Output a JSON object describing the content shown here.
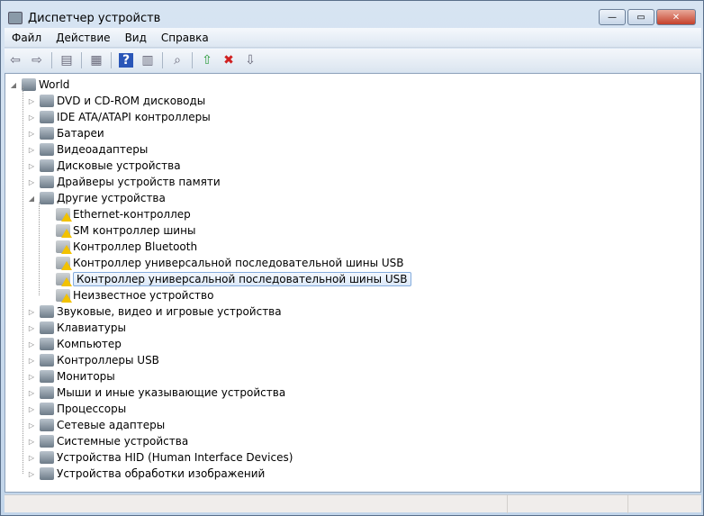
{
  "window": {
    "title": "Диспетчер устройств",
    "minimize": "—",
    "maximize": "▭",
    "close": "✕"
  },
  "menu": [
    "Файл",
    "Действие",
    "Вид",
    "Справка"
  ],
  "toolbar": [
    {
      "icon": "back-icon",
      "g": "⇦"
    },
    {
      "icon": "forward-icon",
      "g": "⇨"
    },
    {
      "sep": true
    },
    {
      "icon": "show-hide-console-tree-icon",
      "g": "▤"
    },
    {
      "sep": true
    },
    {
      "icon": "properties-icon",
      "g": "▦"
    },
    {
      "sep": true
    },
    {
      "icon": "help-icon",
      "g": "?"
    },
    {
      "icon": "show-action-pane-icon",
      "g": "▥"
    },
    {
      "sep": true
    },
    {
      "icon": "scan-hardware-icon",
      "g": "⌕"
    },
    {
      "sep": true
    },
    {
      "icon": "update-driver-icon",
      "g": "⇧"
    },
    {
      "icon": "uninstall-icon",
      "g": "✖"
    },
    {
      "icon": "disable-icon",
      "g": "⇩"
    }
  ],
  "tree": {
    "root": "World",
    "items": [
      {
        "label": "DVD и CD-ROM дисководы"
      },
      {
        "label": "IDE ATA/ATAPI контроллеры"
      },
      {
        "label": "Батареи"
      },
      {
        "label": "Видеоадаптеры"
      },
      {
        "label": "Дисковые устройства"
      },
      {
        "label": "Драйверы устройств памяти"
      },
      {
        "label": "Другие устройства",
        "expanded": true,
        "children": [
          "Ethernet-контроллер",
          "SM контроллер шины",
          "Контроллер Bluetooth",
          "Контроллер универсальной последовательной шины USB",
          "Контроллер универсальной последовательной шины USB",
          "Неизвестное устройство"
        ],
        "selected_child": 4
      },
      {
        "label": "Звуковые, видео и игровые устройства"
      },
      {
        "label": "Клавиатуры"
      },
      {
        "label": "Компьютер"
      },
      {
        "label": "Контроллеры USB"
      },
      {
        "label": "Мониторы"
      },
      {
        "label": "Мыши и иные указывающие устройства"
      },
      {
        "label": "Процессоры"
      },
      {
        "label": "Сетевые адаптеры"
      },
      {
        "label": "Системные устройства"
      },
      {
        "label": "Устройства HID (Human Interface Devices)"
      },
      {
        "label": "Устройства обработки изображений"
      }
    ]
  }
}
